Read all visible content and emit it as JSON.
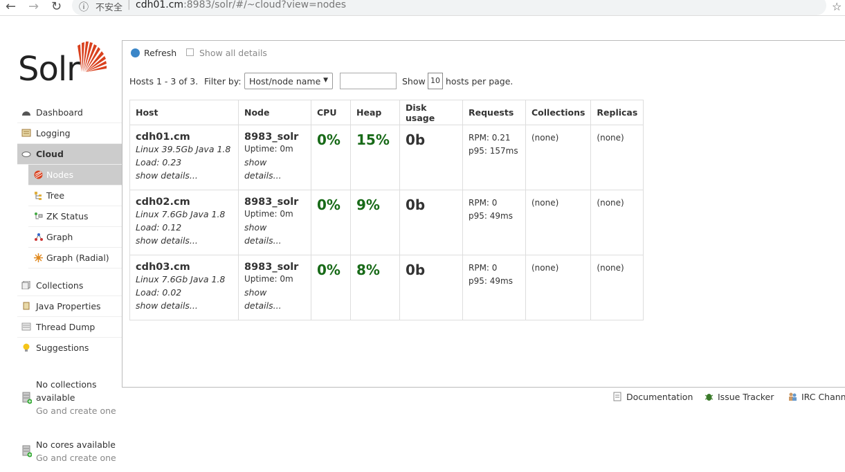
{
  "browser": {
    "insecure_label": "不安全",
    "url_host": "cdh01.cm",
    "url_rest": ":8983/solr/#/~cloud?view=nodes"
  },
  "logo": {
    "text": "Solr"
  },
  "sidebar": {
    "items": [
      {
        "label": "Dashboard",
        "icon": "dashboard-icon"
      },
      {
        "label": "Logging",
        "icon": "logging-icon"
      },
      {
        "label": "Cloud",
        "icon": "cloud-icon"
      }
    ],
    "cloud_sub": [
      {
        "label": "Nodes",
        "icon": "solr-nodes-icon"
      },
      {
        "label": "Tree",
        "icon": "tree-icon"
      },
      {
        "label": "ZK Status",
        "icon": "zk-status-icon"
      },
      {
        "label": "Graph",
        "icon": "graph-icon"
      },
      {
        "label": "Graph (Radial)",
        "icon": "graph-radial-icon"
      }
    ],
    "items2": [
      {
        "label": "Collections",
        "icon": "collections-icon"
      },
      {
        "label": "Java Properties",
        "icon": "java-properties-icon"
      },
      {
        "label": "Thread Dump",
        "icon": "thread-dump-icon"
      },
      {
        "label": "Suggestions",
        "icon": "lightbulb-icon"
      }
    ],
    "no_collections": {
      "line1": "No collections",
      "line2": "available",
      "link": "Go and create one"
    },
    "no_cores": {
      "line1": "No cores available",
      "link": "Go and create one"
    }
  },
  "toolbar": {
    "refresh": "Refresh",
    "show_all": "Show all details"
  },
  "filter": {
    "hosts_text": "Hosts 1 - 3 of 3.",
    "filter_by": "Filter by:",
    "select_value": "Host/node name",
    "show": "Show",
    "per_page_value": "10",
    "per_page_suffix": "hosts per page."
  },
  "table": {
    "headers": [
      "Host",
      "Node",
      "CPU",
      "Heap",
      "Disk usage",
      "Requests",
      "Collections",
      "Replicas"
    ],
    "rows": [
      {
        "host": "cdh01.cm",
        "os": "Linux 39.5Gb Java 1.8",
        "load": "Load: 0.23",
        "host_details": "show details...",
        "node": "8983_solr",
        "uptime": "Uptime: 0m",
        "node_details": "show details...",
        "cpu": "0%",
        "heap": "15%",
        "disk": "0b",
        "rpm": "RPM: 0.21",
        "p95": "p95: 157ms",
        "collections": "(none)",
        "replicas": "(none)"
      },
      {
        "host": "cdh02.cm",
        "os": "Linux 7.6Gb Java 1.8",
        "load": "Load: 0.12",
        "host_details": "show details...",
        "node": "8983_solr",
        "uptime": "Uptime: 0m",
        "node_details": "show details...",
        "cpu": "0%",
        "heap": "9%",
        "disk": "0b",
        "rpm": "RPM: 0",
        "p95": "p95: 49ms",
        "collections": "(none)",
        "replicas": "(none)"
      },
      {
        "host": "cdh03.cm",
        "os": "Linux 7.6Gb Java 1.8",
        "load": "Load: 0.02",
        "host_details": "show details...",
        "node": "8983_solr",
        "uptime": "Uptime: 0m",
        "node_details": "show details...",
        "cpu": "0%",
        "heap": "8%",
        "disk": "0b",
        "rpm": "RPM: 0",
        "p95": "p95: 49ms",
        "collections": "(none)",
        "replicas": "(none)"
      }
    ]
  },
  "footer": {
    "documentation": "Documentation",
    "issue_tracker": "Issue Tracker",
    "irc": "IRC Chann"
  },
  "colors": {
    "green": "#186a18",
    "active_bg": "#cccccc",
    "refresh_blue": "#3a86c8",
    "logo_red": "#d9411e"
  }
}
